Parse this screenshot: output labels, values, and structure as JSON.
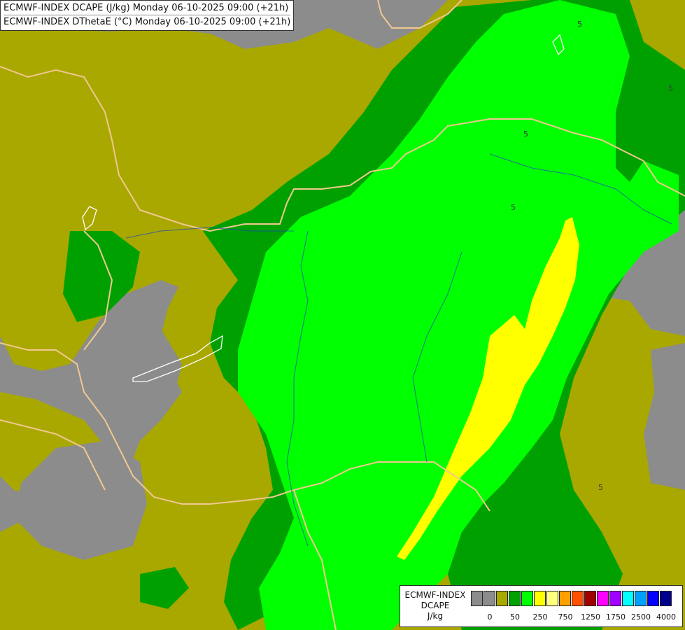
{
  "map": {
    "title_lines": [
      "ECMWF-INDEX DCAPE (J/kg) Monday 06-10-2025 09:00 (+21h)",
      "ECMWF-INDEX DThetaE (°C) Monday 06-10-2025 09:00 (+21h)"
    ],
    "colors": {
      "no_data": "#8c8c8c",
      "olive": "#a8a800",
      "dark_green": "#00a000",
      "green": "#00ff00",
      "yellow": "#ffff00",
      "border": "#f0c890",
      "river": "#2040c0",
      "lake_outline": "#ffffff"
    },
    "contour_labels": [
      "5",
      "5",
      "5",
      "5",
      "5"
    ]
  },
  "legend": {
    "title_lines": [
      "ECMWF-INDEX",
      "DCAPE",
      "J/kg"
    ],
    "swatch_colors": [
      "#8c8c8c",
      "#8c8c8c",
      "#a8a800",
      "#00a000",
      "#00ff00",
      "#ffff00",
      "#ffff80",
      "#ffa000",
      "#ff5000",
      "#a00000",
      "#ff00ff",
      "#a000ff",
      "#00ffff",
      "#00a0ff",
      "#0000ff",
      "#00008c"
    ],
    "tick_labels": [
      "0",
      "50",
      "250",
      "750",
      "1250",
      "1750",
      "2500",
      "4000"
    ]
  }
}
